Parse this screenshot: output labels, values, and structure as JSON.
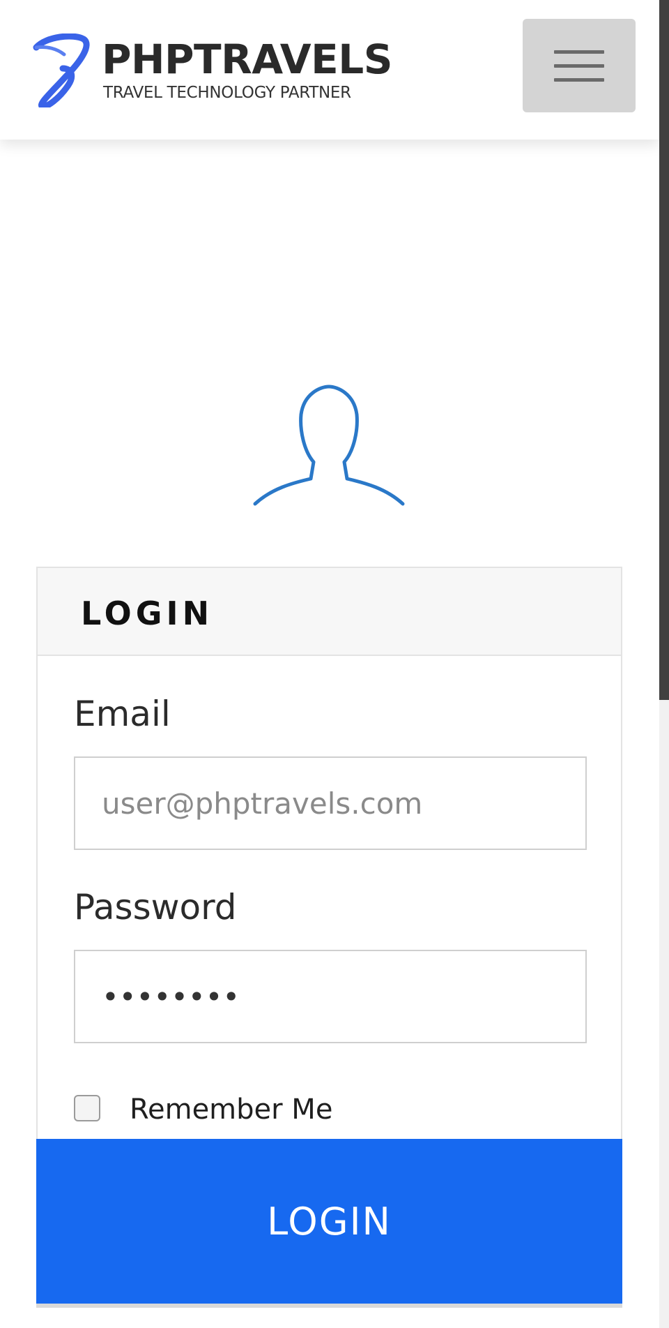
{
  "header": {
    "brand_name": "PHPTRAVELS",
    "tagline": "TRAVEL TECHNOLOGY PARTNER",
    "logo_icon": "phptravels-logo-mark",
    "menu_icon": "hamburger-menu-icon"
  },
  "login": {
    "avatar_icon": "user-silhouette-icon",
    "title": "LOGIN",
    "email_label": "Email",
    "email_placeholder": "user@phptravels.com",
    "password_label": "Password",
    "password_value": "demouser",
    "remember_label": "Remember Me",
    "remember_checked": false,
    "submit_label": "LOGIN"
  },
  "colors": {
    "accent": "#1769f0",
    "logo_blue": "#3a63e8",
    "avatar_blue": "#2a78c8",
    "menu_button_bg": "#d4d4d4"
  }
}
